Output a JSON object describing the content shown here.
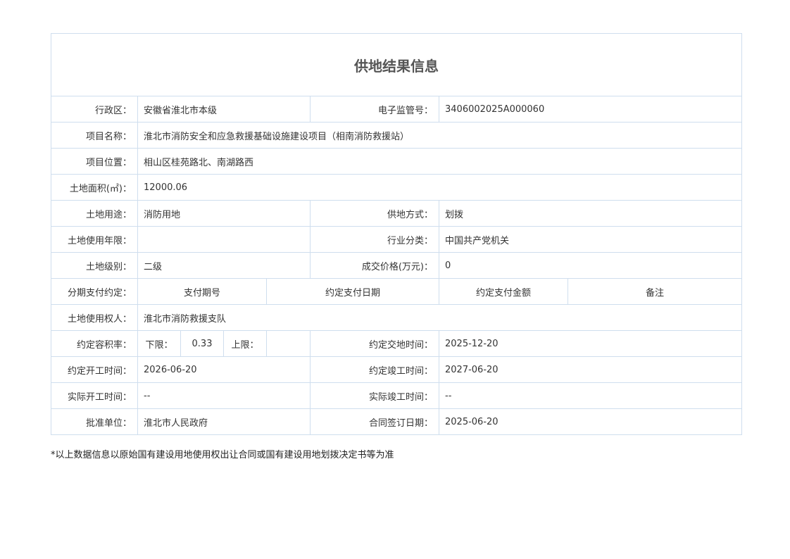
{
  "title": "供地结果信息",
  "rows": {
    "admin_region": {
      "label": "行政区：",
      "value": "安徽省淮北市本级"
    },
    "supervision_no": {
      "label": "电子监管号：",
      "value": "3406002025A000060"
    },
    "project_name": {
      "label": "项目名称：",
      "value": "淮北市消防安全和应急救援基础设施建设项目（相南消防救援站）"
    },
    "project_location": {
      "label": "项目位置：",
      "value": "相山区桂苑路北、南湖路西"
    },
    "land_area": {
      "label": "土地面积(㎡)：",
      "value": "12000.06"
    },
    "land_use": {
      "label": "土地用途：",
      "value": "消防用地"
    },
    "supply_method": {
      "label": "供地方式：",
      "value": "划拨"
    },
    "use_term": {
      "label": "土地使用年限：",
      "value": ""
    },
    "industry": {
      "label": "行业分类：",
      "value": "中国共产党机关"
    },
    "land_grade": {
      "label": "土地级别：",
      "value": "二级"
    },
    "deal_price": {
      "label": "成交价格(万元)：",
      "value": "0"
    },
    "installment": {
      "label": "分期支付约定：",
      "headers": [
        "支付期号",
        "约定支付日期",
        "约定支付金额",
        "备注"
      ]
    },
    "right_holder": {
      "label": "土地使用权人：",
      "value": "淮北市消防救援支队"
    },
    "plot_ratio": {
      "label": "约定容积率：",
      "lower_label": "下限：",
      "lower_value": "0.33",
      "upper_label": "上限：",
      "upper_value": ""
    },
    "handover_time": {
      "label": "约定交地时间：",
      "value": "2025-12-20"
    },
    "start_time": {
      "label": "约定开工时间：",
      "value": "2026-06-20"
    },
    "finish_time": {
      "label": "约定竣工时间：",
      "value": "2027-06-20"
    },
    "actual_start": {
      "label": "实际开工时间：",
      "value": "--"
    },
    "actual_finish": {
      "label": "实际竣工时间：",
      "value": "--"
    },
    "approver": {
      "label": "批准单位：",
      "value": "淮北市人民政府"
    },
    "contract_date": {
      "label": "合同签订日期：",
      "value": "2025-06-20"
    }
  },
  "footnote": "*以上数据信息以原始国有建设用地使用权出让合同或国有建设用地划拨决定书等为准"
}
